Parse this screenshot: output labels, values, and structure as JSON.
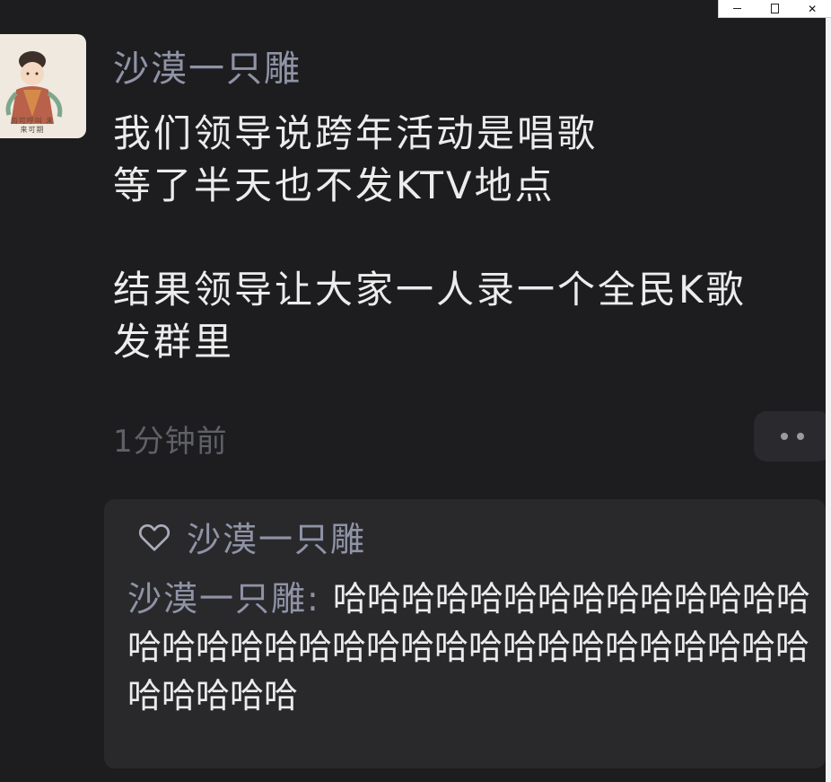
{
  "window": {
    "minimize_label": "–",
    "maximize_label": "",
    "close_label": "✕"
  },
  "post": {
    "avatar_caption": "尚可呼叫 未来可期",
    "username": "沙漠一只雕",
    "lines": [
      "我们领导说跨年活动是唱歌",
      "等了半天也不发KTV地点",
      "",
      "结果领导让大家一人录一个全民K歌",
      "发群里"
    ],
    "timestamp": "1分钟前"
  },
  "likes": {
    "icon": "heart-outline-icon",
    "name": "沙漠一只雕"
  },
  "comment": {
    "author": "沙漠一只雕",
    "separator": ": ",
    "text": "哈哈哈哈哈哈哈哈哈哈哈哈哈哈哈哈哈哈哈哈哈哈哈哈哈哈哈哈哈哈哈哈哈哈哈哈哈哈哈"
  },
  "colors": {
    "background": "#1d1d1f",
    "username": "#8f93a6",
    "text": "#ececec",
    "muted": "#5f6068",
    "panel": "#29292c"
  }
}
